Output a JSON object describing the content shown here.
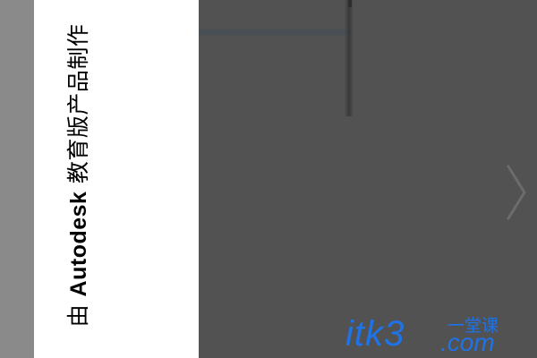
{
  "plot_stamp": {
    "prefix": "由",
    "brand": "Autodesk",
    "suffix": "教育版产品制作"
  },
  "watermark": {
    "main": "itk3",
    "tld": ".com",
    "tagline": "一堂课",
    "color": "#1e73e8"
  },
  "icons": {
    "nav": "chevron-right-icon"
  },
  "colors": {
    "paper": "#ffffff",
    "viewport": "#525252",
    "margin": "#8a8a8a"
  }
}
